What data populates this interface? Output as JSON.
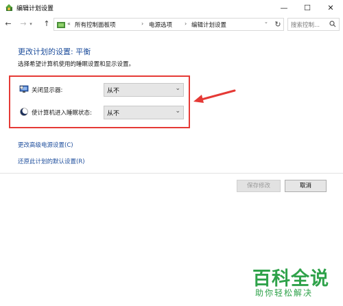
{
  "window": {
    "title": "编辑计划设置",
    "min_glyph": "—",
    "max_glyph": "☐",
    "close_glyph": "✕"
  },
  "navigation": {
    "back_glyph": "←",
    "forward_glyph": "→",
    "forward_dropdown_glyph": "▾",
    "up_glyph": "↑",
    "breadcrumb_overflow": "«",
    "breadcrumbs": [
      "所有控制面板项",
      "电源选项",
      "编辑计划设置"
    ],
    "breadcrumb_separator": "›",
    "dropdown_glyph": "⌄",
    "refresh_glyph": "↻",
    "search_placeholder": "搜索控制..."
  },
  "content": {
    "title": "更改计划的设置: 平衡",
    "description": "选择希望计算机使用的睡眠设置和显示设置。",
    "settings": [
      {
        "label": "关闭显示器:",
        "value": "从不",
        "icon": "monitor-icon"
      },
      {
        "label": "使计算机进入睡眠状态:",
        "value": "从不",
        "icon": "moon-icon"
      }
    ],
    "select_arrow_glyph": "⌄",
    "links": [
      "更改高级电源设置(C)",
      "还原此计划的默认设置(R)"
    ]
  },
  "buttons": {
    "save": "保存修改",
    "cancel": "取消"
  },
  "watermark": {
    "logo": "百科全说",
    "tagline": "助你轻松解决"
  },
  "colors": {
    "accent_text": "#1e4e9c",
    "highlight_box": "#e53935",
    "watermark": "#2fa24a"
  }
}
